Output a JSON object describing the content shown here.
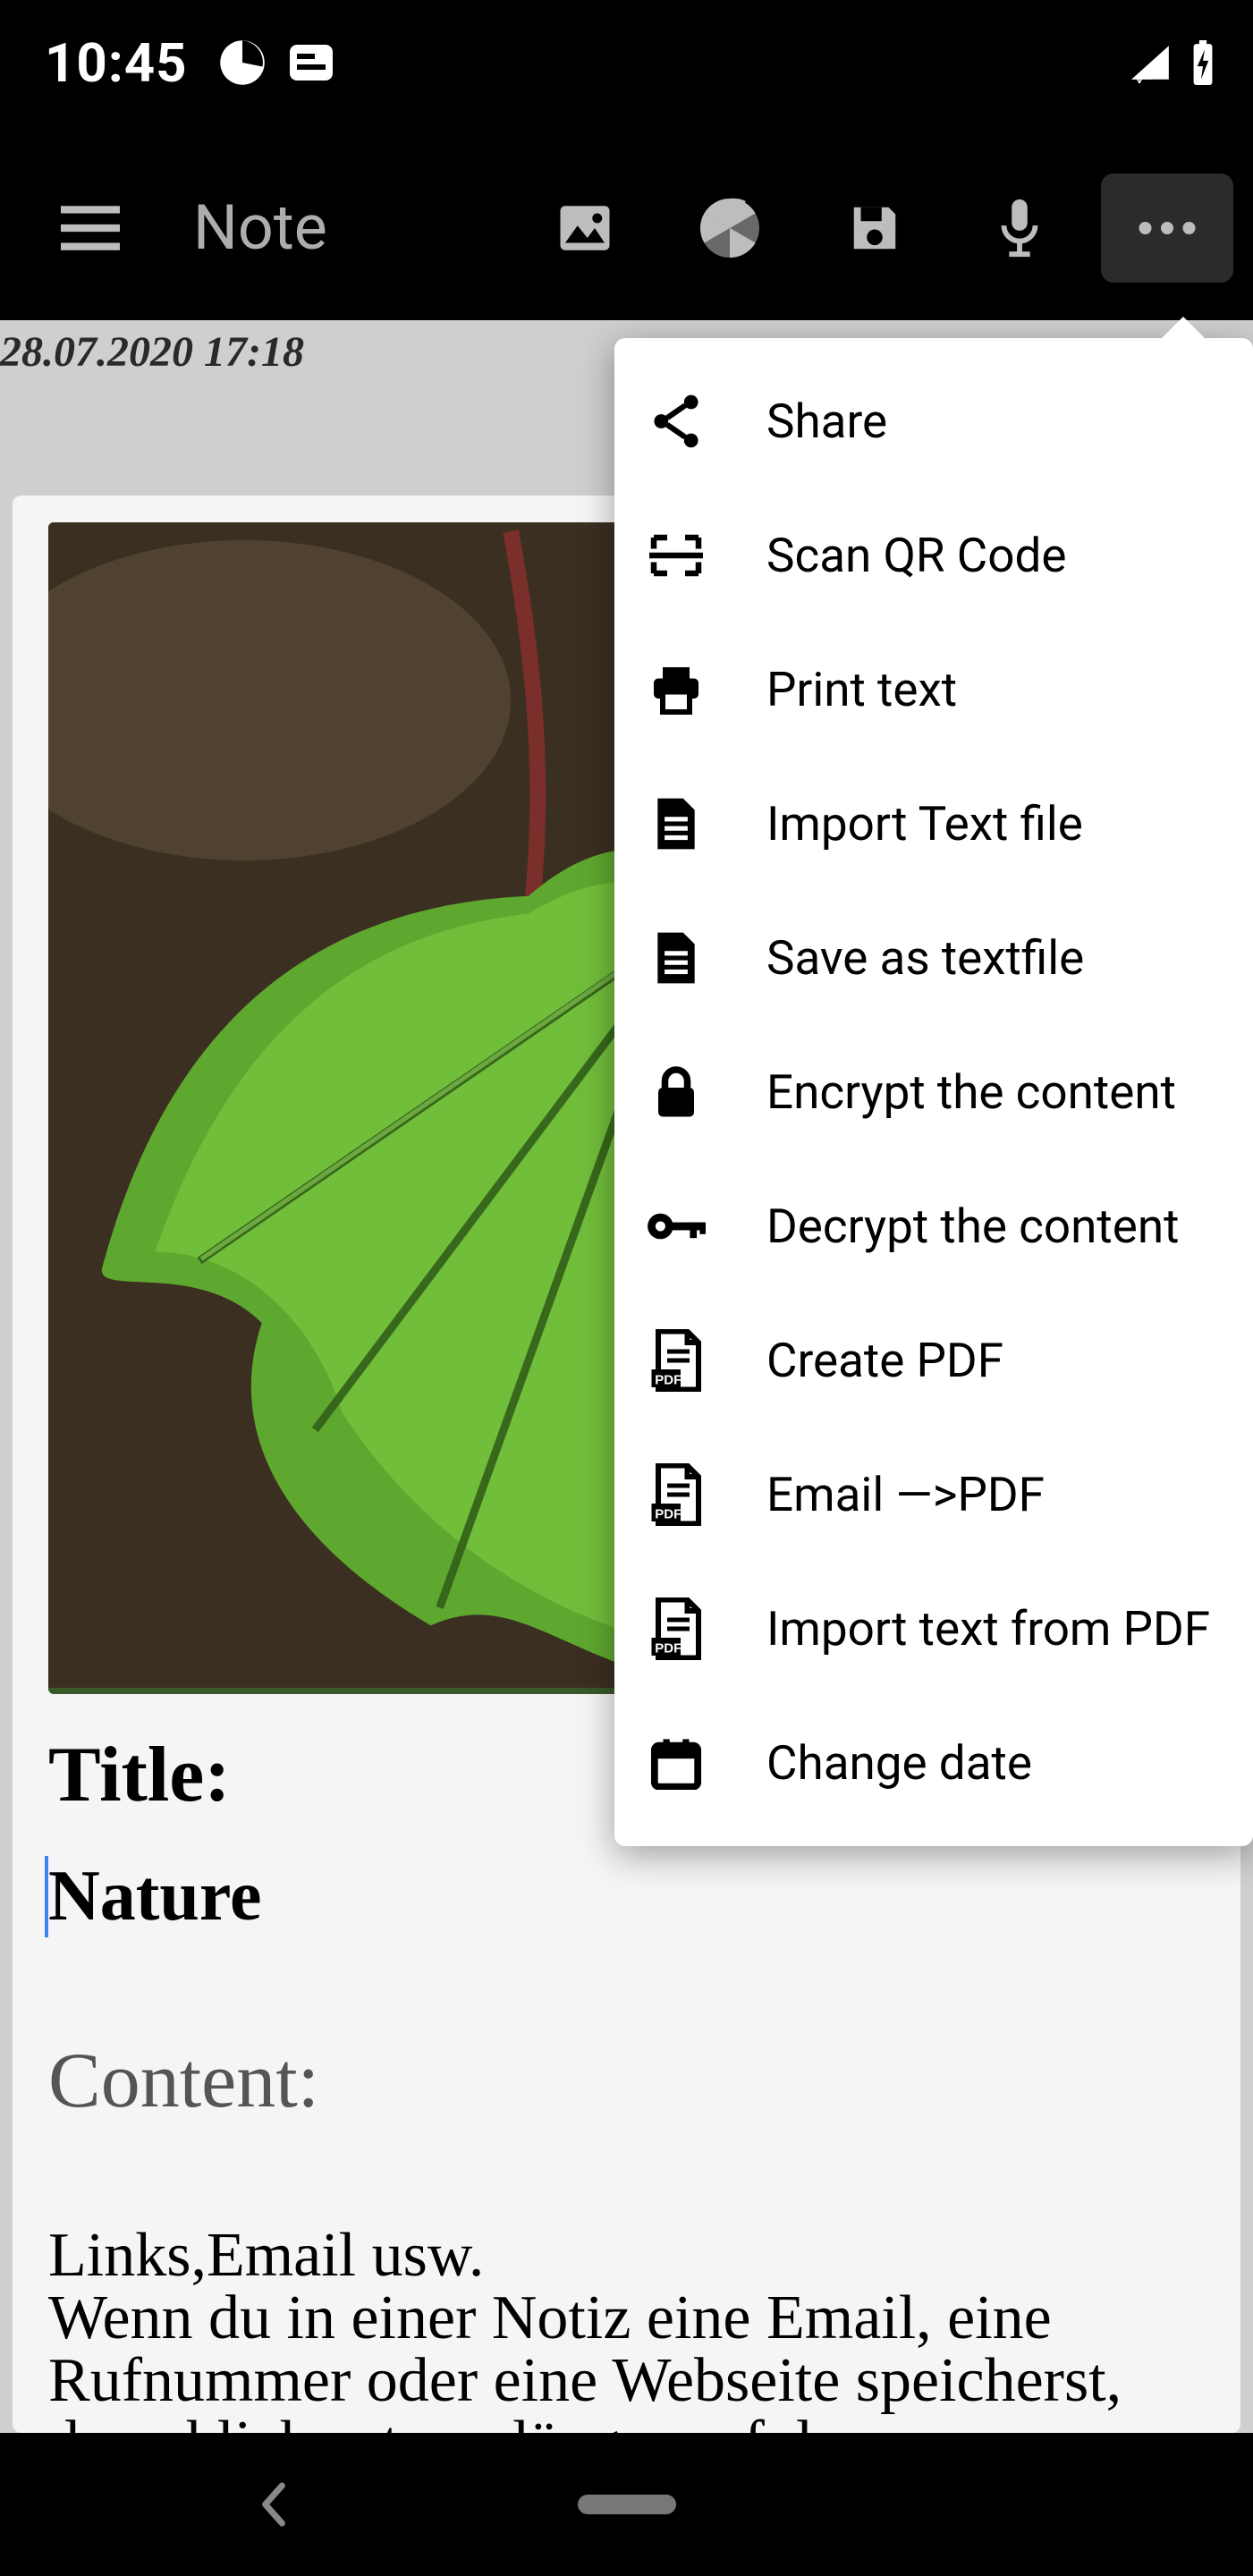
{
  "status": {
    "time": "10:45"
  },
  "appbar": {
    "title": "Note"
  },
  "note": {
    "date": "28.07.2020 17:18",
    "title_label": "Title:",
    "title_value": "Nature",
    "content_label": "Content:",
    "body_line1": "Links,Email usw.",
    "body_rest": "Wenn du in einer Notiz eine Email, eine Rufnummer oder eine Webseite speicherst, dann klicke etwas länger auf den"
  },
  "menu": {
    "items": [
      {
        "icon": "share-icon",
        "label": "Share"
      },
      {
        "icon": "qr-icon",
        "label": "Scan QR Code"
      },
      {
        "icon": "print-icon",
        "label": "Print text"
      },
      {
        "icon": "file-import-icon",
        "label": "Import Text file"
      },
      {
        "icon": "file-save-icon",
        "label": "Save as textfile"
      },
      {
        "icon": "lock-icon",
        "label": "Encrypt the content"
      },
      {
        "icon": "key-icon",
        "label": "Decrypt the content"
      },
      {
        "icon": "pdf-icon",
        "label": "Create PDF"
      },
      {
        "icon": "pdf-icon",
        "label": "Email —>PDF"
      },
      {
        "icon": "pdf-icon",
        "label": "Import text from PDF"
      },
      {
        "icon": "calendar-icon",
        "label": "Change date"
      }
    ]
  }
}
